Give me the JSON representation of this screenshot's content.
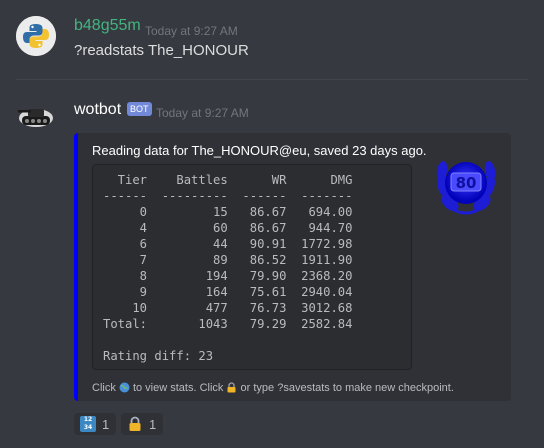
{
  "messages": [
    {
      "username": "b48g55m",
      "username_color": "#43b581",
      "timestamp": "Today at 9:27 AM",
      "text": "?readstats The_HONOUR"
    },
    {
      "username": "wotbot",
      "username_color": "#ffffff",
      "bot_tag": "BOT",
      "timestamp": "Today at 9:27 AM",
      "embed": {
        "accent_color": "#0000ff",
        "description": "Reading data for The_HONOUR@eu, saved 23 days ago.",
        "badge_text": "80",
        "code_lines": [
          "  Tier    Battles      WR      DMG",
          "------  ---------  ------  -------",
          "     0         15   86.67   694.00",
          "     4         60   86.67   944.70",
          "     6         44   90.91  1772.98",
          "     7         89   86.52  1911.90",
          "     8        194   79.90  2368.20",
          "     9        164   75.61  2940.04",
          "    10        477   76.73  3012.68",
          "Total:       1043   79.29  2582.84",
          "",
          "Rating diff: 23"
        ],
        "footer": {
          "part1": "Click ",
          "part2": " to view stats. Click ",
          "part3": " or type ?savestats to make new checkpoint."
        }
      },
      "reactions": [
        {
          "emoji": "input-numbers-icon",
          "count": "1"
        },
        {
          "emoji": "lock-icon",
          "count": "1"
        }
      ]
    }
  ]
}
